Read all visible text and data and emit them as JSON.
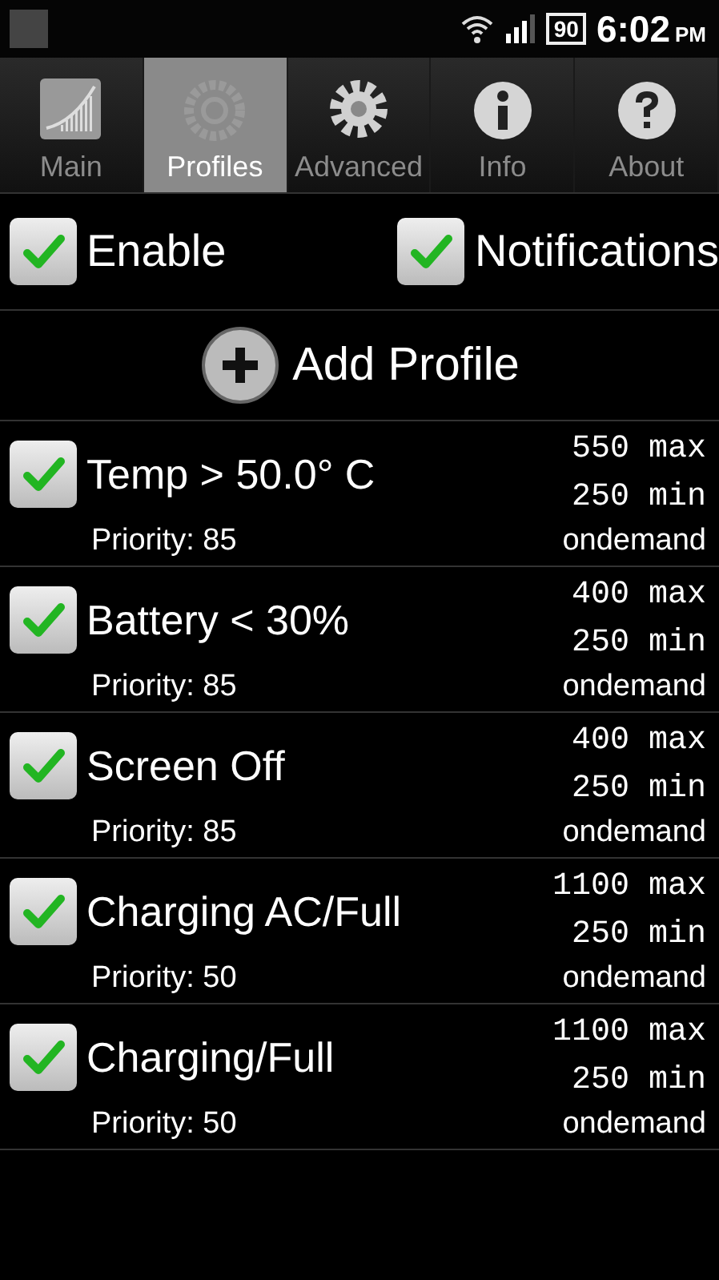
{
  "status_bar": {
    "battery": "90",
    "time": "6:02",
    "meridiem": "PM"
  },
  "tabs": [
    {
      "label": "Main",
      "kind": "chart",
      "selected": false
    },
    {
      "label": "Profiles",
      "kind": "ring",
      "selected": true
    },
    {
      "label": "Advanced",
      "kind": "gear",
      "selected": false
    },
    {
      "label": "Info",
      "kind": "info",
      "selected": false
    },
    {
      "label": "About",
      "kind": "help",
      "selected": false
    }
  ],
  "toggles": [
    {
      "label": "Enable",
      "checked": true
    },
    {
      "label": "Notifications",
      "checked": true
    }
  ],
  "add_button": {
    "label": "Add Profile"
  },
  "profiles": [
    {
      "name": "Temp > 50.0° C",
      "checked": true,
      "max": "550 max",
      "min": "250 min",
      "priority": "Priority: 85",
      "governor": "ondemand"
    },
    {
      "name": "Battery < 30%",
      "checked": true,
      "max": "400 max",
      "min": "250 min",
      "priority": "Priority: 85",
      "governor": "ondemand"
    },
    {
      "name": "Screen Off",
      "checked": true,
      "max": "400 max",
      "min": "250 min",
      "priority": "Priority: 85",
      "governor": "ondemand"
    },
    {
      "name": "Charging AC/Full",
      "checked": true,
      "max": "1100 max",
      "min": "250 min",
      "priority": "Priority: 50",
      "governor": "ondemand"
    },
    {
      "name": "Charging/Full",
      "checked": true,
      "max": "1100 max",
      "min": "250 min",
      "priority": "Priority: 50",
      "governor": "ondemand"
    }
  ]
}
